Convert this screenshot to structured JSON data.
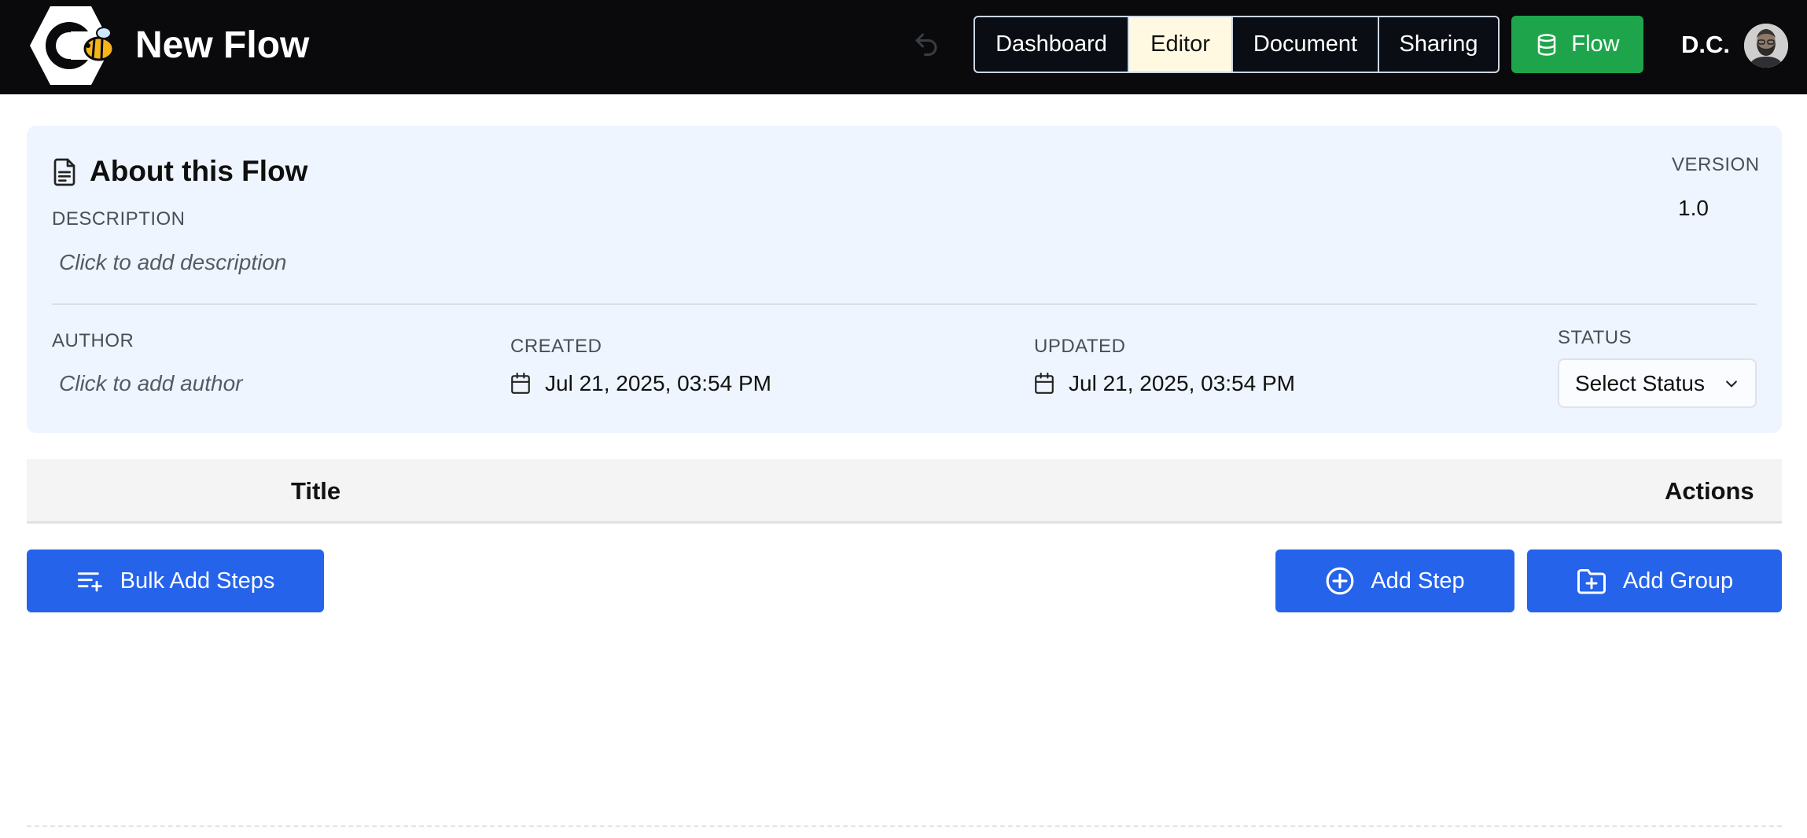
{
  "header": {
    "title": "New Flow",
    "tabs": [
      {
        "label": "Dashboard",
        "active": false
      },
      {
        "label": "Editor",
        "active": true
      },
      {
        "label": "Document",
        "active": false
      },
      {
        "label": "Sharing",
        "active": false
      }
    ],
    "flow_button": "Flow",
    "user_initials": "D.C.",
    "colors": {
      "bar": "#0a0a0c",
      "flow_button": "#1ea54b",
      "active_tab": "#fff9e1"
    }
  },
  "about": {
    "title": "About this Flow",
    "description_label": "DESCRIPTION",
    "description_placeholder": "Click to add description",
    "version_label": "VERSION",
    "version_value": "1.0",
    "author_label": "AUTHOR",
    "author_placeholder": "Click to add author",
    "created_label": "CREATED",
    "created_value": "Jul 21, 2025, 03:54 PM",
    "updated_label": "UPDATED",
    "updated_value": "Jul 21, 2025, 03:54 PM",
    "status_label": "STATUS",
    "status_selected": "Select Status"
  },
  "table": {
    "columns": [
      "Title",
      "Actions"
    ]
  },
  "actions": {
    "bulk_add": "Bulk Add Steps",
    "add_step": "Add Step",
    "add_group": "Add Group",
    "color": "#2563eb"
  }
}
